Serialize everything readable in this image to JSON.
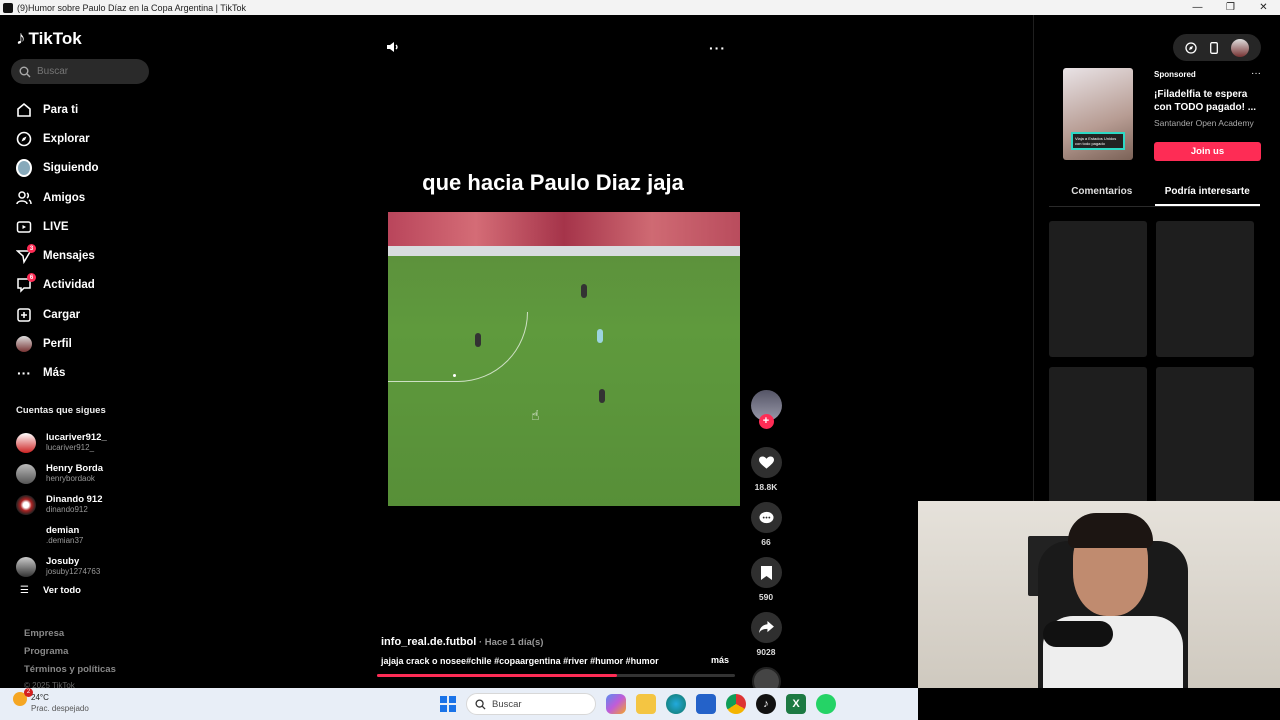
{
  "window": {
    "title": "(9)Humor sobre Paulo Díaz en la Copa Argentina | TikTok",
    "controls": [
      "—",
      "❐",
      "✕"
    ]
  },
  "sidebar": {
    "logo": "TikTok",
    "search_placeholder": "Buscar",
    "nav": [
      {
        "label": "Para ti",
        "icon": "home-icon"
      },
      {
        "label": "Explorar",
        "icon": "compass-icon"
      },
      {
        "label": "Siguiendo",
        "icon": "following-avatar-icon"
      },
      {
        "label": "Amigos",
        "icon": "friends-icon"
      },
      {
        "label": "LIVE",
        "icon": "live-icon"
      },
      {
        "label": "Mensajes",
        "icon": "messages-icon",
        "badge": "3"
      },
      {
        "label": "Actividad",
        "icon": "activity-icon",
        "badge": "6"
      },
      {
        "label": "Cargar",
        "icon": "upload-icon"
      },
      {
        "label": "Perfil",
        "icon": "profile-avatar-icon"
      },
      {
        "label": "Más",
        "icon": "more-icon"
      }
    ],
    "following_title": "Cuentas que sigues",
    "following": [
      {
        "name": "lucariver912_",
        "handle": "lucariver912_"
      },
      {
        "name": "Henry Borda",
        "handle": "henrybordaok"
      },
      {
        "name": "Dinando 912",
        "handle": "dinando912"
      },
      {
        "name": "demian",
        "handle": ".demian37"
      },
      {
        "name": "Josuby",
        "handle": "josuby1274763"
      }
    ],
    "see_all": "Ver todo",
    "footer": [
      "Empresa",
      "Programa",
      "Términos y políticas"
    ],
    "copyright": "© 2025 TikTok"
  },
  "video": {
    "caption_overlay": "que hacia Paulo Diaz jaja",
    "username": "info_real.de.futbol",
    "time": " · Hace 1 día(s)",
    "description": "jajaja crack o nosee#chile #copaargentina #river #humor #humor",
    "more": "más",
    "progress": 0.67,
    "likes": "18.8K",
    "comments": "66",
    "saves": "590",
    "shares": "9028"
  },
  "right": {
    "ad": {
      "sponsored": "Sponsored",
      "title": "¡Filadelfia te espera con TODO pagado! ...",
      "brand": "Santander Open Academy",
      "button": "Join us",
      "thumb_text": "Viaja a Estados Unidos con todo pagado"
    },
    "tabs": [
      "Comentarios",
      "Podría interesarte"
    ],
    "active_tab": "Podría interesarte"
  },
  "taskbar": {
    "temperature": "24°C",
    "weather": "Prac. despejado",
    "weather_badge": "2",
    "search_placeholder": "Buscar"
  },
  "colors": {
    "accent": "#fe2c55",
    "background": "#000000",
    "panel": "#1e1e1e"
  }
}
